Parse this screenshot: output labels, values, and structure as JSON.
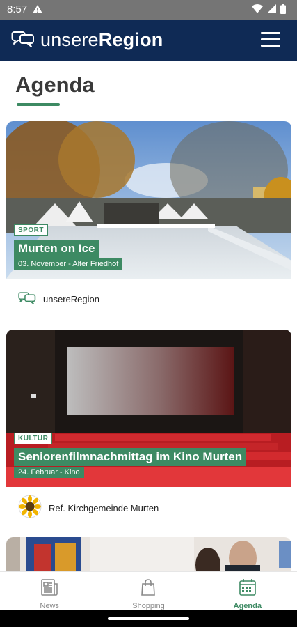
{
  "status_bar": {
    "time": "8:57"
  },
  "app": {
    "brand_light": "unsere",
    "brand_bold": "Region",
    "colors": {
      "header": "#0f2a55",
      "accent": "#3d8a63",
      "status_bar": "#757575"
    }
  },
  "page": {
    "title": "Agenda"
  },
  "events": [
    {
      "category": "SPORT",
      "title": "Murten on Ice",
      "subtitle": "03. November - Alter Friedhof",
      "organizer": "unsereRegion",
      "organizer_icon": "chat-bubbles-icon"
    },
    {
      "category": "KULTUR",
      "title": "Seniorenfilmnachmittag im Kino Murten",
      "subtitle": "24. Februar - Kino",
      "organizer": "Ref. Kirchgemeinde Murten",
      "organizer_icon": "sunflower-avatar"
    }
  ],
  "bottom_nav": {
    "items": [
      {
        "label": "News",
        "icon": "newspaper-icon",
        "active": false
      },
      {
        "label": "Shopping",
        "icon": "shopping-bag-icon",
        "active": false
      },
      {
        "label": "Agenda",
        "icon": "calendar-icon",
        "active": true
      }
    ]
  }
}
